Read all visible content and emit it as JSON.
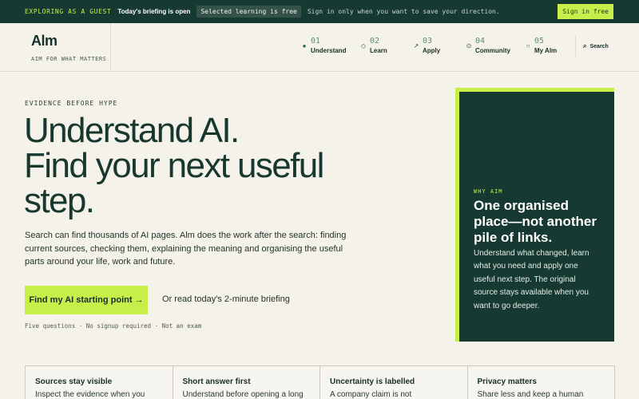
{
  "banner": {
    "guest_label": "EXPLORING AS A GUEST",
    "briefing_status": "Today's briefing is open",
    "pill": "Selected learning is free",
    "message": "Sign in only when you want to save your direction.",
    "signin_label": "Sign in free"
  },
  "brand": {
    "logo": "Alm",
    "tagline": "AIM FOR WHAT MATTERS"
  },
  "nav": {
    "items": [
      {
        "num": "01",
        "label": "Understand",
        "icon": "●"
      },
      {
        "num": "02",
        "label": "Learn",
        "icon": "◇"
      },
      {
        "num": "03",
        "label": "Apply",
        "icon": "↗"
      },
      {
        "num": "04",
        "label": "Community",
        "icon": "⊙"
      },
      {
        "num": "05",
        "label": "My Alm",
        "icon": "○"
      }
    ],
    "search_label": "Search"
  },
  "hero": {
    "eyebrow": "EVIDENCE BEFORE HYPE",
    "headline_1": "Understand AI.",
    "headline_2": "Find your next useful",
    "headline_3": "step.",
    "lede": "Search can find thousands of AI pages. Alm does the work after the search: finding current sources, checking them, explaining the meaning and organising the useful parts around your life, work and future.",
    "cta_label": "Find my AI starting point →",
    "alt_link": "Or read today's 2-minute briefing",
    "fine_print": "Five questions · No signup required · Not an exam"
  },
  "card": {
    "kicker": "WHY AIM",
    "title": "One organised place—not another pile of links.",
    "body": "Understand what changed, learn what you need and apply one useful next step. The original source stays available when you want to go deeper."
  },
  "features": [
    {
      "title": "Sources stay visible",
      "desc": "Inspect the evidence when you"
    },
    {
      "title": "Short answer first",
      "desc": "Understand before opening a long"
    },
    {
      "title": "Uncertainty is labelled",
      "desc": "A company claim is not"
    },
    {
      "title": "Privacy matters",
      "desc": "Share less and keep a human"
    }
  ],
  "colors": {
    "accent": "#c6ef4a",
    "dark_green": "#163a31",
    "background": "#f5f2ea"
  }
}
